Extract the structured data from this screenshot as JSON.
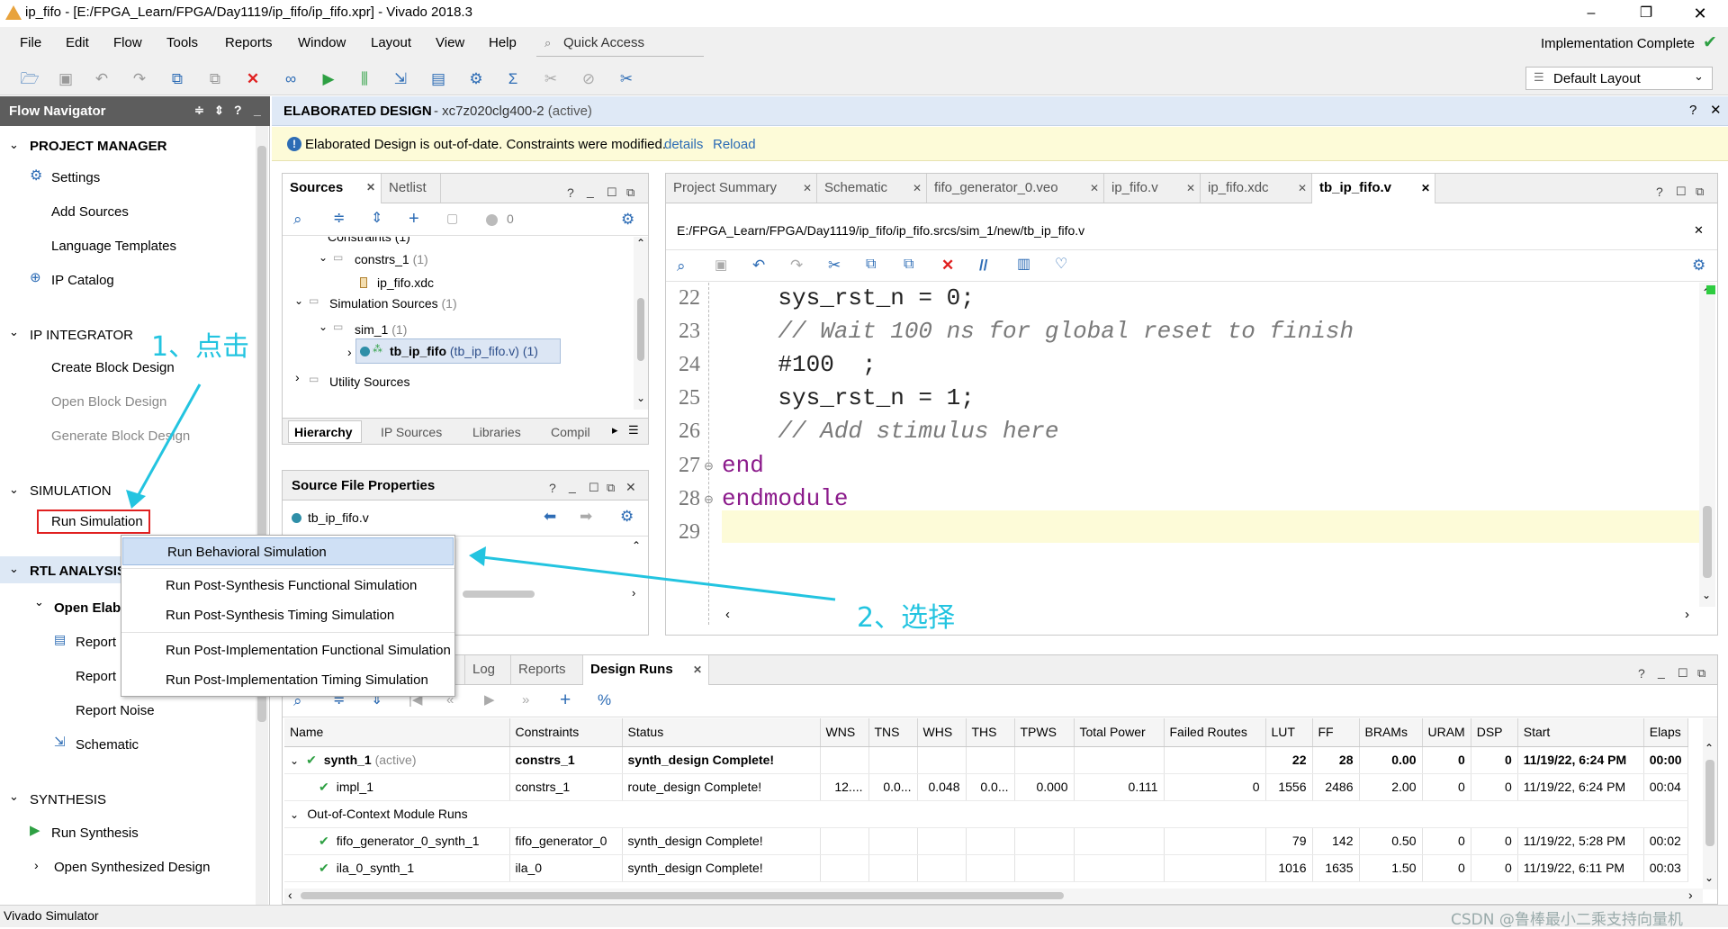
{
  "window": {
    "title": "ip_fifo - [E:/FPGA_Learn/FPGA/Day1119/ip_fifo/ip_fifo.xpr] - Vivado 2018.3"
  },
  "menu": [
    "File",
    "Edit",
    "Flow",
    "Tools",
    "Reports",
    "Window",
    "Layout",
    "View",
    "Help"
  ],
  "quick_access": "Quick Access",
  "status_top": "Implementation Complete",
  "layout_select": "Default Layout",
  "flow_navigator": {
    "title": "Flow Navigator",
    "sections": {
      "project_manager": "PROJECT MANAGER",
      "settings": "Settings",
      "add_sources": "Add Sources",
      "language_templates": "Language Templates",
      "ip_catalog": "IP Catalog",
      "ip_integrator": "IP INTEGRATOR",
      "create_block": "Create Block Design",
      "open_block": "Open Block Design",
      "generate_block": "Generate Block Design",
      "simulation": "SIMULATION",
      "run_simulation": "Run Simulation",
      "rtl_analysis": "RTL ANALYSIS",
      "open_elab": "Open Elab",
      "report1": "Report I",
      "report2": "Report I",
      "report_noise": "Report Noise",
      "schematic": "Schematic",
      "synthesis": "SYNTHESIS",
      "run_synthesis": "Run Synthesis",
      "open_synth": "Open Synthesized Design"
    }
  },
  "editor_header": {
    "title": "ELABORATED DESIGN",
    "part": " - xc7z020clg400-2",
    "active": " (active)"
  },
  "notice": {
    "text": "Elaborated Design is out-of-date. Constraints were modified.",
    "details": "details",
    "reload": "Reload"
  },
  "sources": {
    "tabs": [
      "Sources",
      "Netlist"
    ],
    "badge": "0",
    "tree": {
      "cut": "Constraints (1)",
      "constrs": "constrs_1",
      "constrs_count": " (1)",
      "xdc": "ip_fifo.xdc",
      "simsrc": "Simulation Sources",
      "simsrc_count": " (1)",
      "sim1": "sim_1",
      "sim1_count": " (1)",
      "tb": "tb_ip_fifo",
      "tb_detail": " (tb_ip_fifo.v) (1)",
      "utility": "Utility Sources"
    },
    "bottom_tabs": [
      "Hierarchy",
      "IP Sources",
      "Libraries",
      "Compil"
    ]
  },
  "source_props": {
    "title": "Source File Properties",
    "file": "tb_ip_fifo.v"
  },
  "context_menu": [
    "Run Behavioral Simulation",
    "Run Post-Synthesis Functional Simulation",
    "Run Post-Synthesis Timing Simulation",
    "Run Post-Implementation Functional Simulation",
    "Run Post-Implementation Timing Simulation"
  ],
  "editor": {
    "tabs": [
      "Project Summary",
      "Schematic",
      "fifo_generator_0.veo",
      "ip_fifo.v",
      "ip_fifo.xdc",
      "tb_ip_fifo.v"
    ],
    "path": "E:/FPGA_Learn/FPGA/Day1119/ip_fifo/ip_fifo.srcs/sim_1/new/tb_ip_fifo.v",
    "lines": [
      {
        "n": "22",
        "text": "    sys_rst_n = 0;",
        "kind": "code"
      },
      {
        "n": "23",
        "text": "    // Wait 100 ns for global reset to finish",
        "kind": "comment"
      },
      {
        "n": "24",
        "text": "    #100  ;",
        "kind": "code"
      },
      {
        "n": "25",
        "text": "    sys_rst_n = 1;",
        "kind": "code"
      },
      {
        "n": "26",
        "text": "    // Add stimulus here",
        "kind": "comment"
      },
      {
        "n": "27",
        "text": "end",
        "kind": "kw"
      },
      {
        "n": "28",
        "text": "endmodule",
        "kind": "kw"
      },
      {
        "n": "29",
        "text": "",
        "kind": "code"
      }
    ]
  },
  "runs": {
    "tabs": [
      "Log",
      "Reports",
      "Design Runs"
    ],
    "columns": [
      "Name",
      "Constraints",
      "Status",
      "WNS",
      "TNS",
      "WHS",
      "THS",
      "TPWS",
      "Total Power",
      "Failed Routes",
      "LUT",
      "FF",
      "BRAMs",
      "URAM",
      "DSP",
      "Start",
      "Elaps"
    ],
    "rows": [
      {
        "name": "synth_1",
        "suffix": " (active)",
        "cons": "constrs_1",
        "status": "synth_design Complete!",
        "wns": "",
        "tns": "",
        "whs": "",
        "ths": "",
        "tpws": "",
        "power": "",
        "failed": "",
        "lut": "22",
        "ff": "28",
        "bram": "0.00",
        "uram": "0",
        "dsp": "0",
        "start": "11/19/22, 6:24 PM",
        "elaps": "00:00",
        "bold": true
      },
      {
        "name": "impl_1",
        "suffix": "",
        "cons": "constrs_1",
        "status": "route_design Complete!",
        "wns": "12....",
        "tns": "0.0...",
        "whs": "0.048",
        "ths": "0.0...",
        "tpws": "0.000",
        "power": "0.111",
        "failed": "0",
        "lut": "1556",
        "ff": "2486",
        "bram": "2.00",
        "uram": "0",
        "dsp": "0",
        "start": "11/19/22, 6:24 PM",
        "elaps": "00:04",
        "bold": false
      },
      {
        "group": "Out-of-Context Module Runs"
      },
      {
        "name": "fifo_generator_0_synth_1",
        "suffix": "",
        "cons": "fifo_generator_0",
        "status": "synth_design Complete!",
        "wns": "",
        "tns": "",
        "whs": "",
        "ths": "",
        "tpws": "",
        "power": "",
        "failed": "",
        "lut": "79",
        "ff": "142",
        "bram": "0.50",
        "uram": "0",
        "dsp": "0",
        "start": "11/19/22, 5:28 PM",
        "elaps": "00:02",
        "bold": false
      },
      {
        "name": "ila_0_synth_1",
        "suffix": "",
        "cons": "ila_0",
        "status": "synth_design Complete!",
        "wns": "",
        "tns": "",
        "whs": "",
        "ths": "",
        "tpws": "",
        "power": "",
        "failed": "",
        "lut": "1016",
        "ff": "1635",
        "bram": "1.50",
        "uram": "0",
        "dsp": "0",
        "start": "11/19/22, 6:11 PM",
        "elaps": "00:03",
        "bold": false
      }
    ]
  },
  "annotations": {
    "step1": "1、点击",
    "step2": "2、选择"
  },
  "statusbar": "Vivado Simulator",
  "watermark": "CSDN @鲁棒最小二乘支持向量机",
  "colors": {
    "accent": "#2d6cb5",
    "annotation": "#23c4e0",
    "green": "#2ea043",
    "red": "#e02020",
    "highlight": "#fdfbd8"
  }
}
